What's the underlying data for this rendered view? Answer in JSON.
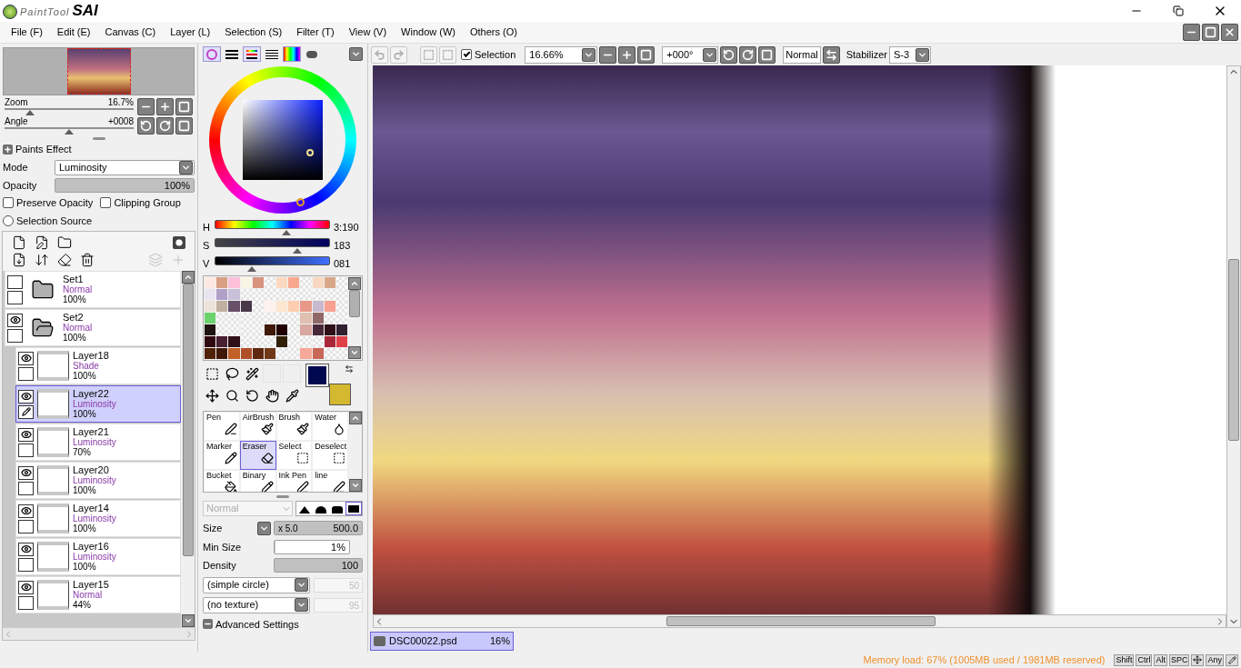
{
  "app": {
    "logo_text": "PaintTool",
    "logo_brand": "SAI"
  },
  "menu": [
    "File (F)",
    "Edit (E)",
    "Canvas (C)",
    "Layer (L)",
    "Selection (S)",
    "Filter (T)",
    "View (V)",
    "Window (W)",
    "Others (O)"
  ],
  "navigator": {
    "zoom": {
      "label": "Zoom",
      "value": "16.7%",
      "level": 0.2
    },
    "angle": {
      "label": "Angle",
      "value": "+0008",
      "level": 0.5
    }
  },
  "paints_effect": {
    "title": "Paints Effect",
    "mode_label": "Mode",
    "mode_value": "Luminosity",
    "opacity": {
      "label": "Opacity",
      "value": "100%",
      "level": 1
    },
    "checkboxes": [
      {
        "label": "Preserve Opacity",
        "checked": false
      },
      {
        "label": "Clipping Group",
        "checked": false
      }
    ],
    "radio": {
      "label": "Selection Source",
      "selected": false
    }
  },
  "layers": [
    {
      "kind": "folder",
      "name": "Set1",
      "mode": "Normal",
      "opacity": "100%",
      "visible": false,
      "selected": false
    },
    {
      "kind": "folder",
      "name": "Set2",
      "mode": "Normal",
      "opacity": "100%",
      "visible": true,
      "selected": false,
      "children": [
        {
          "kind": "layer",
          "name": "Layer18",
          "mode": "Shade",
          "opacity": "100%",
          "visible": true,
          "selected": false
        },
        {
          "kind": "layer",
          "name": "Layer22",
          "mode": "Luminosity",
          "opacity": "100%",
          "visible": true,
          "selected": true
        },
        {
          "kind": "layer",
          "name": "Layer21",
          "mode": "Luminosity",
          "opacity": "70%",
          "visible": true,
          "selected": false
        },
        {
          "kind": "layer",
          "name": "Layer20",
          "mode": "Luminosity",
          "opacity": "100%",
          "visible": true,
          "selected": false
        },
        {
          "kind": "layer",
          "name": "Layer14",
          "mode": "Luminosity",
          "opacity": "100%",
          "visible": true,
          "selected": false
        },
        {
          "kind": "layer",
          "name": "Layer16",
          "mode": "Luminosity",
          "opacity": "100%",
          "visible": true,
          "selected": false
        },
        {
          "kind": "layer",
          "name": "Layer15",
          "mode": "Normal",
          "opacity": "44%",
          "visible": true,
          "selected": false
        }
      ]
    }
  ],
  "color": {
    "sliders": [
      {
        "label": "H",
        "value": "3:190",
        "level": 0.62
      },
      {
        "label": "S",
        "value": "183",
        "level": 0.72
      },
      {
        "label": "V",
        "value": "081",
        "level": 0.32
      }
    ],
    "foreground": {
      "color": "#000850"
    },
    "background": {
      "color": "#d4b830"
    },
    "swatches": [
      [
        {
          "kind": "color",
          "color": "#fde9e1"
        },
        {
          "kind": "color",
          "color": "#d9a084"
        },
        {
          "kind": "color",
          "color": "#fcc0d8"
        },
        {
          "kind": "color",
          "color": "#f8f5e6"
        },
        {
          "kind": "color",
          "color": "#d99480"
        },
        {
          "kind": "empty"
        },
        {
          "kind": "color",
          "color": "#fbd9c0"
        },
        {
          "kind": "color",
          "color": "#f9a890"
        },
        {
          "kind": "empty"
        },
        {
          "kind": "color",
          "color": "#f8d8c0"
        },
        {
          "kind": "color",
          "color": "#d9a888"
        },
        {
          "kind": "empty"
        }
      ],
      [
        {
          "kind": "color",
          "color": "#e8e4f0"
        },
        {
          "kind": "color",
          "color": "#b0a0c8"
        },
        {
          "kind": "color",
          "color": "#c8c0d8"
        },
        {
          "kind": "empty"
        },
        {
          "kind": "empty"
        },
        {
          "kind": "empty"
        },
        {
          "kind": "empty"
        },
        {
          "kind": "empty"
        },
        {
          "kind": "empty"
        },
        {
          "kind": "empty"
        },
        {
          "kind": "empty"
        },
        {
          "kind": "empty"
        }
      ],
      [
        {
          "kind": "color",
          "color": "#ece4d8"
        },
        {
          "kind": "color",
          "color": "#c0b0a0"
        },
        {
          "kind": "color",
          "color": "#685068"
        },
        {
          "kind": "color",
          "color": "#483848"
        },
        {
          "kind": "empty"
        },
        {
          "kind": "color",
          "color": "#fef2ef"
        },
        {
          "kind": "color",
          "color": "#fde6cf"
        },
        {
          "kind": "color",
          "color": "#fccdaf"
        },
        {
          "kind": "color",
          "color": "#e89888"
        },
        {
          "kind": "color",
          "color": "#c8b8d0"
        },
        {
          "kind": "color",
          "color": "#f9a090"
        },
        {
          "kind": "empty"
        }
      ],
      [
        {
          "kind": "color",
          "color": "#6cd26c"
        },
        {
          "kind": "empty"
        },
        {
          "kind": "empty"
        },
        {
          "kind": "empty"
        },
        {
          "kind": "empty"
        },
        {
          "kind": "empty"
        },
        {
          "kind": "empty"
        },
        {
          "kind": "empty"
        },
        {
          "kind": "color",
          "color": "#e0c0b0"
        },
        {
          "kind": "color",
          "color": "#906868"
        },
        {
          "kind": "empty"
        },
        {
          "kind": "empty"
        }
      ],
      [
        {
          "kind": "color",
          "color": "#201410"
        },
        {
          "kind": "empty"
        },
        {
          "kind": "empty"
        },
        {
          "kind": "empty"
        },
        {
          "kind": "empty"
        },
        {
          "kind": "color",
          "color": "#401808"
        },
        {
          "kind": "color",
          "color": "#200000"
        },
        {
          "kind": "empty"
        },
        {
          "kind": "color",
          "color": "#d8a8a0"
        },
        {
          "kind": "color",
          "color": "#482838"
        },
        {
          "kind": "color",
          "color": "#301018"
        },
        {
          "kind": "color",
          "color": "#302030"
        }
      ],
      [
        {
          "kind": "color",
          "color": "#300810"
        },
        {
          "kind": "color",
          "color": "#482030"
        },
        {
          "kind": "color",
          "color": "#301018"
        },
        {
          "kind": "empty"
        },
        {
          "kind": "empty"
        },
        {
          "kind": "empty"
        },
        {
          "kind": "color",
          "color": "#302008"
        },
        {
          "kind": "empty"
        },
        {
          "kind": "empty"
        },
        {
          "kind": "empty"
        },
        {
          "kind": "color",
          "color": "#a82838"
        },
        {
          "kind": "color",
          "color": "#e04048"
        }
      ],
      [
        {
          "kind": "color",
          "color": "#502008"
        },
        {
          "kind": "color",
          "color": "#401808"
        },
        {
          "kind": "color",
          "color": "#c06028"
        },
        {
          "kind": "color",
          "color": "#b05028"
        },
        {
          "kind": "color",
          "color": "#602810"
        },
        {
          "kind": "color",
          "color": "#703818"
        },
        {
          "kind": "empty"
        },
        {
          "kind": "empty"
        },
        {
          "kind": "color",
          "color": "#f8a898"
        },
        {
          "kind": "color",
          "color": "#c86858"
        },
        {
          "kind": "empty"
        },
        {
          "kind": "empty"
        }
      ]
    ]
  },
  "brushes": [
    {
      "label": "Pen",
      "selected": false
    },
    {
      "label": "AirBrush",
      "selected": false
    },
    {
      "label": "Brush",
      "selected": false
    },
    {
      "label": "Water",
      "selected": false
    },
    {
      "label": "Marker",
      "selected": false
    },
    {
      "label": "Eraser",
      "selected": true
    },
    {
      "label": "Select",
      "selected": false
    },
    {
      "label": "Deselect",
      "selected": false
    },
    {
      "label": "Bucket",
      "selected": false
    },
    {
      "label": "Binary",
      "selected": false
    },
    {
      "label": "Ink Pen",
      "selected": false
    },
    {
      "label": "line",
      "selected": false
    }
  ],
  "brush_settings": {
    "blend_mode": "Normal",
    "shapes": [
      {
        "selected": false
      },
      {
        "selected": false
      },
      {
        "selected": false
      },
      {
        "selected": true
      }
    ],
    "size": {
      "label": "Size",
      "multiplier": "x 5.0",
      "value": "500.0",
      "level": 1
    },
    "min_size": {
      "label": "Min Size",
      "value": "1%",
      "level": 0.01
    },
    "density": {
      "label": "Density",
      "value": "100",
      "level": 1
    },
    "shape": "(simple circle)",
    "shape_value": "50",
    "texture": "(no texture)",
    "texture_value": "95",
    "advanced": "Advanced Settings"
  },
  "toolbar": {
    "selection_label": "Selection",
    "selection_checked": true,
    "zoom": "16.66%",
    "angle": "+000°",
    "blend": "Normal",
    "stabilizer_label": "Stabilizer",
    "stabilizer": "S-3"
  },
  "document_tab": {
    "name": "DSC00022.psd",
    "zoom": "16%",
    "selected": true
  },
  "status": {
    "memory": "Memory load: 67% (1005MB used / 1981MB reserved)",
    "keys": [
      {
        "kind": "text",
        "label": "Shift"
      },
      {
        "kind": "text",
        "label": "Ctrl"
      },
      {
        "kind": "text",
        "label": "Alt"
      },
      {
        "kind": "text",
        "label": "SPC"
      },
      {
        "kind": "move"
      },
      {
        "kind": "text",
        "label": "Any"
      },
      {
        "kind": "pen"
      }
    ]
  }
}
